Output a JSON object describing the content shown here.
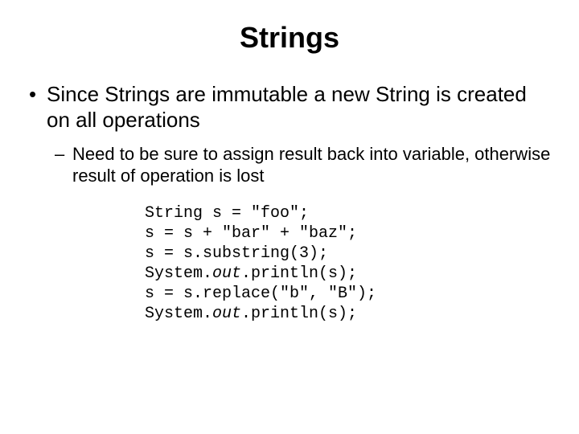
{
  "title": "Strings",
  "bullet1": "Since Strings are immutable a new String is created on all operations",
  "bullet2": "Need to be sure to assign result back into variable, otherwise result of operation is lost",
  "code": {
    "l1": "String s = \"foo\";",
    "l2": "s = s + \"bar\" + \"baz\";",
    "l3a": "s = s.",
    "l3b": "substring",
    "l3c": "(3);",
    "l4a": "System.",
    "l4b": "out",
    "l4c": ".println(s);",
    "l5": "s = s.replace(\"b\", \"B\");",
    "l6a": "System.",
    "l6b": "out",
    "l6c": ".println(s);"
  }
}
